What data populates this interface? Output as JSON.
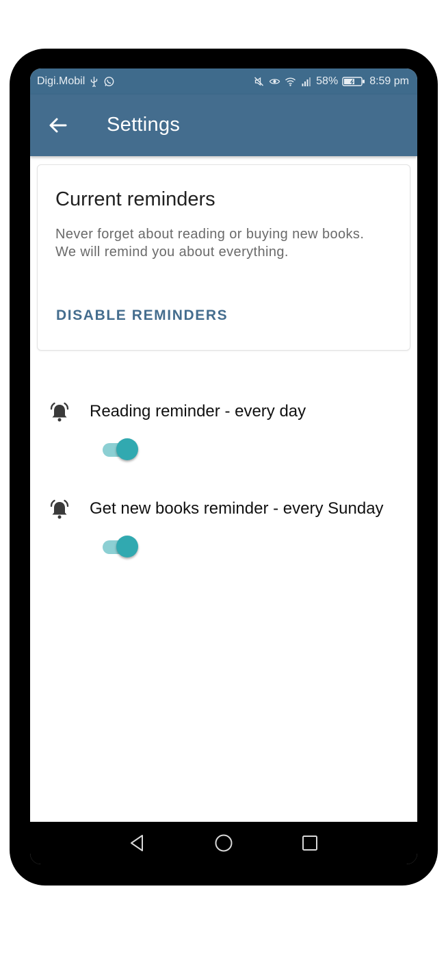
{
  "status_bar": {
    "carrier": "Digi.Mobil",
    "signal_percent_text": "58%",
    "time": "8:59 pm",
    "icons": [
      "usb-icon",
      "whatsapp-icon",
      "mute-icon",
      "eye-comfort-icon",
      "wifi-icon",
      "cell-signal-icon",
      "battery-icon"
    ]
  },
  "app_bar": {
    "title": "Settings",
    "back_icon": "arrow-left-icon"
  },
  "card": {
    "title": "Current reminders",
    "text": "Never forget about reading or buying new books. We will remind you about everything.",
    "action_label": "DISABLE REMINDERS"
  },
  "settings": [
    {
      "label": "Reading reminder - every day",
      "icon": "alarm-bell-icon",
      "enabled": true
    },
    {
      "label": "Get new books reminder - every Sunday",
      "icon": "alarm-bell-icon",
      "enabled": true
    }
  ],
  "nav_bar": {
    "icons": [
      "back-triangle-icon",
      "home-circle-icon",
      "recents-square-icon"
    ]
  },
  "colors": {
    "primary": "#446d8e",
    "accent": "#31a9b0",
    "accent_light": "#8ccfd3"
  }
}
